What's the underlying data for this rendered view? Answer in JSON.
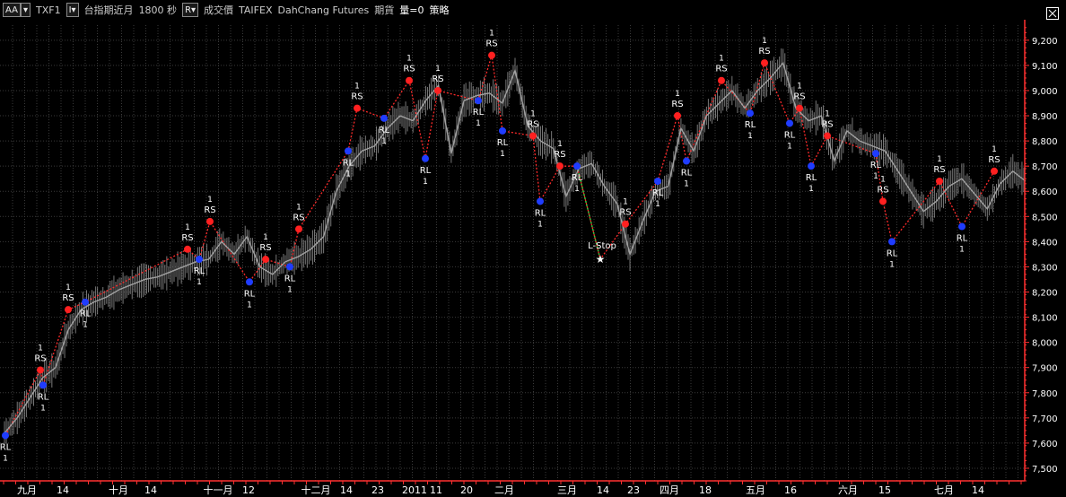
{
  "toolbar": {
    "aa_label": "AA",
    "symbol": "TXF1",
    "name": "台指期近月",
    "interval": "1800 秒",
    "field": "成交價",
    "exchange": "TAIFEX",
    "broker": "DahChang Futures",
    "market": "期貨",
    "volume": "量=0",
    "strategy": "策略"
  },
  "chart_data": {
    "type": "line",
    "y_ticks": [
      "7,500",
      "7,600",
      "7,700",
      "7,800",
      "7,900",
      "8,000",
      "8,100",
      "8,200",
      "8,300",
      "8,400",
      "8,500",
      "8,600",
      "8,700",
      "8,800",
      "8,900",
      "9,000",
      "9,100",
      "9,200"
    ],
    "ylim": [
      7450,
      9260
    ],
    "x_ticks": [
      "九月",
      "14",
      "十月",
      "14",
      "十一月",
      "12",
      "十二月",
      "14",
      "23",
      "2011",
      "11",
      "20",
      "二月",
      "三月",
      "14",
      "23",
      "四月",
      "18",
      "五月",
      "16",
      "六月",
      "15",
      "七月",
      "14"
    ],
    "series": [
      {
        "values": [
          7640,
          7700,
          7780,
          7860,
          7900,
          8050,
          8130,
          8160,
          8180,
          8210,
          8230,
          8250,
          8260,
          8280,
          8300,
          8320,
          8330,
          8400,
          8350,
          8420,
          8300,
          8270,
          8320,
          8340,
          8370,
          8420,
          8600,
          8700,
          8760,
          8780,
          8850,
          8900,
          8880,
          8960,
          9020,
          8750,
          8960,
          8980,
          8990,
          8950,
          9080,
          8860,
          8800,
          8770,
          8580,
          8690,
          8710,
          8620,
          8550,
          8350,
          8480,
          8600,
          8620,
          8850,
          8760,
          8900,
          8950,
          9000,
          8930,
          9000,
          9050,
          9110,
          8930,
          8880,
          8900,
          8720,
          8840,
          8800,
          8780,
          8760,
          8680,
          8600,
          8520,
          8560,
          8620,
          8650,
          8590,
          8530,
          8630,
          8680,
          8640
        ]
      }
    ],
    "trade_signals": [
      {
        "type": "RL",
        "qty": "1",
        "value": 7630
      },
      {
        "type": "RS",
        "qty": "1",
        "value": 7890
      },
      {
        "type": "RL",
        "qty": "1",
        "value": 7830
      },
      {
        "type": "RS",
        "qty": "1",
        "value": 8130
      },
      {
        "type": "RL",
        "qty": "1",
        "value": 8160
      },
      {
        "type": "RS",
        "qty": "1",
        "value": 8370
      },
      {
        "type": "RL",
        "qty": "1",
        "value": 8330
      },
      {
        "type": "RS",
        "qty": "1",
        "value": 8480
      },
      {
        "type": "RL",
        "qty": "1",
        "value": 8240
      },
      {
        "type": "RS",
        "qty": "1",
        "value": 8330
      },
      {
        "type": "RL",
        "qty": "1",
        "value": 8300
      },
      {
        "type": "RS",
        "qty": "1",
        "value": 8450
      },
      {
        "type": "RL",
        "qty": "1",
        "value": 8760
      },
      {
        "type": "RS",
        "qty": "1",
        "value": 8930
      },
      {
        "type": "RL",
        "qty": "1",
        "value": 8890
      },
      {
        "type": "RS",
        "qty": "1",
        "value": 9040
      },
      {
        "type": "RL",
        "qty": "1",
        "value": 8730
      },
      {
        "type": "RS",
        "qty": "1",
        "value": 9000
      },
      {
        "type": "RL",
        "qty": "1",
        "value": 8960
      },
      {
        "type": "RS",
        "qty": "1",
        "value": 9140
      },
      {
        "type": "RL",
        "qty": "1",
        "value": 8840
      },
      {
        "type": "RS",
        "qty": "1",
        "value": 8820
      },
      {
        "type": "RL",
        "qty": "1",
        "value": 8560
      },
      {
        "type": "RS",
        "qty": "1",
        "value": 8700
      },
      {
        "type": "RL",
        "qty": "1",
        "value": 8700
      },
      {
        "type": "L-Stop",
        "qty": "",
        "value": 8330
      },
      {
        "type": "RS",
        "qty": "1",
        "value": 8470
      },
      {
        "type": "RL",
        "qty": "1",
        "value": 8640
      },
      {
        "type": "RS",
        "qty": "1",
        "value": 8900
      },
      {
        "type": "RL",
        "qty": "1",
        "value": 8720
      },
      {
        "type": "RS",
        "qty": "1",
        "value": 9040
      },
      {
        "type": "RL",
        "qty": "1",
        "value": 8910
      },
      {
        "type": "RS",
        "qty": "1",
        "value": 9110
      },
      {
        "type": "RL",
        "qty": "1",
        "value": 8870
      },
      {
        "type": "RS",
        "qty": "1",
        "value": 8930
      },
      {
        "type": "RL",
        "qty": "1",
        "value": 8700
      },
      {
        "type": "RS",
        "qty": "1",
        "value": 8820
      },
      {
        "type": "RL",
        "qty": "1",
        "value": 8750
      },
      {
        "type": "RS",
        "qty": "1",
        "value": 8560
      },
      {
        "type": "RL",
        "qty": "1",
        "value": 8400
      },
      {
        "type": "RS",
        "qty": "1",
        "value": 8640
      },
      {
        "type": "RL",
        "qty": "1",
        "value": 8460
      },
      {
        "type": "RS",
        "qty": "1",
        "value": 8680
      }
    ],
    "grid": true,
    "colors": {
      "price": "#a0a0a0",
      "up_segment": "#2ea82e",
      "stop_line": "#2ecc40",
      "trade_line": "#ff2a2a",
      "buy_marker": "#1f3cff",
      "sell_marker": "#ff2020",
      "axis": "#ff3030",
      "background": "#000000",
      "grid": "#3a3a3a",
      "text": "#ffffff"
    }
  }
}
